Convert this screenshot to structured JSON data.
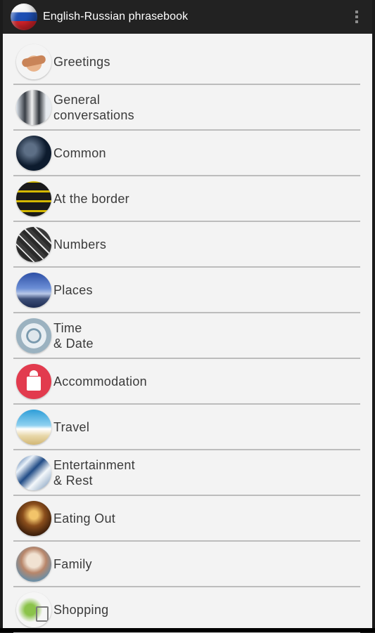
{
  "app_bar": {
    "title": "English-Russian phrasebook",
    "icon": "russian-flag-icon",
    "overflow_icon": "vertical-dots-icon"
  },
  "categories": [
    {
      "label": "Greetings",
      "icon": "handshake-icon"
    },
    {
      "label": "General\nconversations",
      "icon": "business-people-icon"
    },
    {
      "label": "Common",
      "icon": "people-talking-icon"
    },
    {
      "label": "At the border",
      "icon": "border-sign-icon"
    },
    {
      "label": "Numbers",
      "icon": "numbers-icon"
    },
    {
      "label": "Places",
      "icon": "city-skyline-icon"
    },
    {
      "label": "Time\n& Date",
      "icon": "clock-icon"
    },
    {
      "label": "Accommodation",
      "icon": "hotel-icon"
    },
    {
      "label": "Travel",
      "icon": "beach-icon"
    },
    {
      "label": "Entertainment\n& Rest",
      "icon": "entertainment-icon"
    },
    {
      "label": "Eating Out",
      "icon": "restaurant-icon"
    },
    {
      "label": "Family",
      "icon": "family-icon"
    },
    {
      "label": "Shopping",
      "icon": "shopping-cart-icon"
    }
  ],
  "colors": {
    "app_bar": "#222222",
    "list_background": "#f3f3f3",
    "divider": "#bcbcbc",
    "text": "#3a3a3a"
  }
}
